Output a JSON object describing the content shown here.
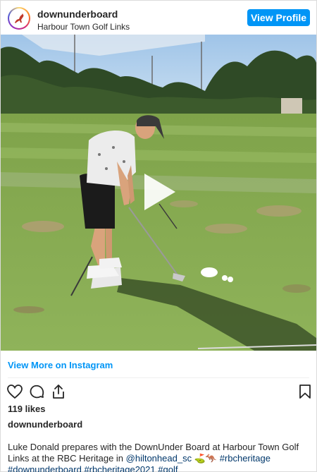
{
  "header": {
    "username": "downunderboard",
    "location": "Harbour Town Golf Links",
    "view_profile_label": "View Profile"
  },
  "media": {
    "type": "video",
    "play_icon": "play-icon"
  },
  "footer": {
    "view_more_label": "View More on Instagram",
    "likes": "119 likes",
    "author": "downunderboard"
  },
  "caption": {
    "text_1": "Luke Donald prepares with the DownUnder Board at Harbour Town Golf Links at the RBC Heritage in ",
    "mention": "@hiltonhead_sc",
    "emoji": " ⛳🦘 ",
    "tags": [
      "#rbcheritage",
      "#downunderboard",
      "#rbcheritage2021",
      "#golf"
    ]
  },
  "icons": {
    "like": "heart-icon",
    "comment": "comment-icon",
    "share": "share-icon",
    "save": "bookmark-icon"
  },
  "colors": {
    "accent": "#0095f6",
    "text": "#262626",
    "link": "#00376b"
  }
}
